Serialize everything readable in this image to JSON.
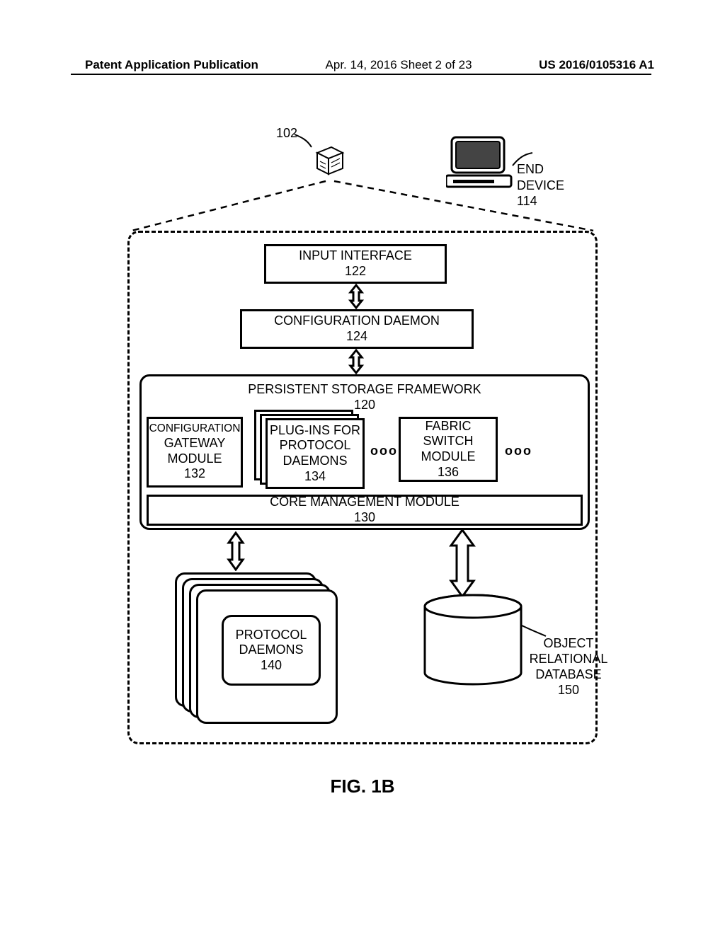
{
  "header": {
    "left": "Patent Application Publication",
    "mid": "Apr. 14, 2016  Sheet 2 of 23",
    "right": "US 2016/0105316 A1"
  },
  "refs": {
    "r102": "102"
  },
  "top": {
    "end_device_label": "END DEVICE",
    "end_device_num": "114"
  },
  "blocks": {
    "input_interface_label": "INPUT INTERFACE",
    "input_interface_num": "122",
    "config_daemon_label": "CONFIGURATION DAEMON",
    "config_daemon_num": "124",
    "psf_label": "PERSISTENT STORAGE FRAMEWORK",
    "psf_num": "120",
    "cg_label1": "CONFIGURATION",
    "cg_label2": "GATEWAY",
    "cg_label3": "MODULE",
    "cg_num": "132",
    "plugins_label1": "PLUG-INS FOR",
    "plugins_label2": "PROTOCOL",
    "plugins_label3": "DAEMONS",
    "plugins_num": "134",
    "fabric_label1": "FABRIC SWITCH",
    "fabric_label2": "MODULE",
    "fabric_num": "136",
    "core_label": "CORE MANAGEMENT MODULE",
    "core_num": "130",
    "pd_label1": "PROTOCOL",
    "pd_label2": "DAEMONS",
    "pd_num": "140",
    "db_label1": "OBJECT",
    "db_label2": "RELATIONAL",
    "db_label3": "DATABASE",
    "db_num": "150"
  },
  "figure": {
    "caption": "FIG. 1B"
  }
}
